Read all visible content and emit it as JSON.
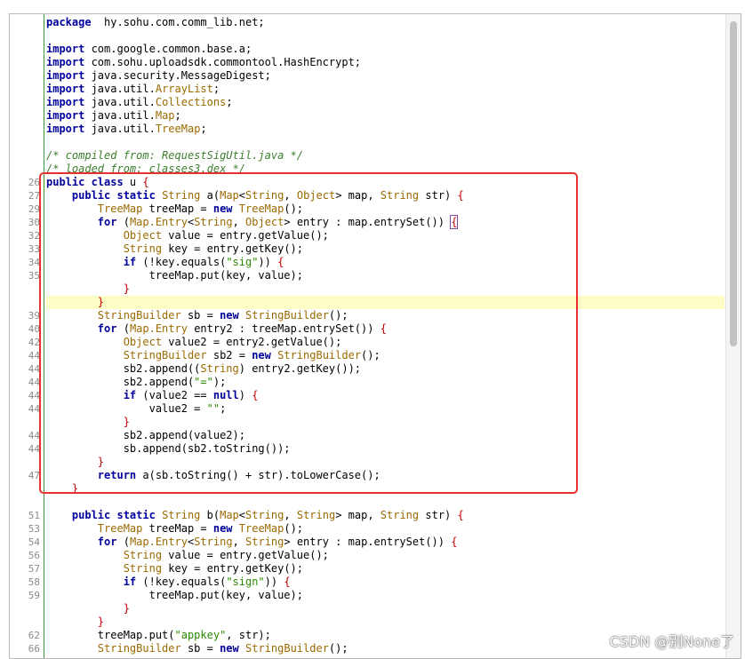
{
  "watermark": "CSDN @别None了",
  "lines": [
    {
      "ln": "",
      "segs": [
        [
          "kw",
          "package"
        ],
        [
          "",
          "  hy.sohu.com.comm_lib.net;"
        ]
      ]
    },
    {
      "ln": "",
      "segs": []
    },
    {
      "ln": "",
      "segs": [
        [
          "kw",
          "import"
        ],
        [
          "",
          " com.google.common.base.a;"
        ]
      ]
    },
    {
      "ln": "",
      "segs": [
        [
          "kw",
          "import"
        ],
        [
          "",
          " com.sohu.uploadsdk.commontool.HashEncrypt;"
        ]
      ]
    },
    {
      "ln": "",
      "segs": [
        [
          "kw",
          "import"
        ],
        [
          "",
          " java.security.MessageDigest;"
        ]
      ]
    },
    {
      "ln": "",
      "segs": [
        [
          "kw",
          "import"
        ],
        [
          "",
          " java.util."
        ],
        [
          "ty",
          "ArrayList"
        ],
        [
          "",
          ";"
        ]
      ]
    },
    {
      "ln": "",
      "segs": [
        [
          "kw",
          "import"
        ],
        [
          "",
          " java.util."
        ],
        [
          "ty",
          "Collections"
        ],
        [
          "",
          ";"
        ]
      ]
    },
    {
      "ln": "",
      "segs": [
        [
          "kw",
          "import"
        ],
        [
          "",
          " java.util."
        ],
        [
          "ty",
          "Map"
        ],
        [
          "",
          ";"
        ]
      ]
    },
    {
      "ln": "",
      "segs": [
        [
          "kw",
          "import"
        ],
        [
          "",
          " java.util."
        ],
        [
          "ty",
          "TreeMap"
        ],
        [
          "",
          ";"
        ]
      ]
    },
    {
      "ln": "",
      "segs": []
    },
    {
      "ln": "",
      "segs": [
        [
          "cm",
          "/* compiled from: RequestSigUtil.java */"
        ]
      ]
    },
    {
      "ln": "",
      "segs": [
        [
          "cm",
          "/* loaded from: classes3.dex */"
        ]
      ]
    },
    {
      "ln": "26",
      "segs": [
        [
          "kw",
          "public class"
        ],
        [
          "",
          " u "
        ],
        [
          "br",
          "{"
        ]
      ]
    },
    {
      "ln": "27",
      "segs": [
        [
          "",
          "    "
        ],
        [
          "kw",
          "public static"
        ],
        [
          "",
          " "
        ],
        [
          "ty",
          "String"
        ],
        [
          "",
          " a("
        ],
        [
          "ty",
          "Map"
        ],
        [
          "",
          "<"
        ],
        [
          "ty",
          "String"
        ],
        [
          "",
          ", "
        ],
        [
          "ty",
          "Object"
        ],
        [
          "",
          "> map, "
        ],
        [
          "ty",
          "String"
        ],
        [
          "",
          " str) "
        ],
        [
          "br",
          "{"
        ]
      ]
    },
    {
      "ln": "29",
      "segs": [
        [
          "",
          "        "
        ],
        [
          "ty",
          "TreeMap"
        ],
        [
          "",
          " treeMap = "
        ],
        [
          "kw",
          "new"
        ],
        [
          "",
          " "
        ],
        [
          "ty",
          "TreeMap"
        ],
        [
          "",
          "();"
        ]
      ]
    },
    {
      "ln": "30",
      "segs": [
        [
          "",
          "        "
        ],
        [
          "kw",
          "for"
        ],
        [
          "",
          " ("
        ],
        [
          "ty",
          "Map.Entry"
        ],
        [
          "",
          "<"
        ],
        [
          "ty",
          "String"
        ],
        [
          "",
          ", "
        ],
        [
          "ty",
          "Object"
        ],
        [
          "",
          "> entry : map.entrySet()) "
        ],
        [
          "cur",
          "{"
        ]
      ]
    },
    {
      "ln": "32",
      "segs": [
        [
          "",
          "            "
        ],
        [
          "ty",
          "Object"
        ],
        [
          "",
          " value = entry.getValue();"
        ]
      ]
    },
    {
      "ln": "33",
      "segs": [
        [
          "",
          "            "
        ],
        [
          "ty",
          "String"
        ],
        [
          "",
          " key = entry.getKey();"
        ]
      ]
    },
    {
      "ln": "34",
      "segs": [
        [
          "",
          "            "
        ],
        [
          "kw",
          "if"
        ],
        [
          "",
          " (!key.equals("
        ],
        [
          "str",
          "\"sig\""
        ],
        [
          "",
          ")) "
        ],
        [
          "br",
          "{"
        ]
      ]
    },
    {
      "ln": "35",
      "segs": [
        [
          "",
          "                treeMap.put(key, value);"
        ]
      ]
    },
    {
      "ln": "",
      "segs": [
        [
          "",
          "            "
        ],
        [
          "br",
          "}"
        ]
      ]
    },
    {
      "ln": "",
      "hl": true,
      "segs": [
        [
          "",
          "        "
        ],
        [
          "br",
          "}"
        ]
      ]
    },
    {
      "ln": "39",
      "segs": [
        [
          "",
          "        "
        ],
        [
          "ty",
          "StringBuilder"
        ],
        [
          "",
          " sb = "
        ],
        [
          "kw",
          "new"
        ],
        [
          "",
          " "
        ],
        [
          "ty",
          "StringBuilder"
        ],
        [
          "",
          "();"
        ]
      ]
    },
    {
      "ln": "40",
      "segs": [
        [
          "",
          "        "
        ],
        [
          "kw",
          "for"
        ],
        [
          "",
          " ("
        ],
        [
          "ty",
          "Map.Entry"
        ],
        [
          "",
          " entry2 : treeMap.entrySet()) "
        ],
        [
          "br",
          "{"
        ]
      ]
    },
    {
      "ln": "42",
      "segs": [
        [
          "",
          "            "
        ],
        [
          "ty",
          "Object"
        ],
        [
          "",
          " value2 = entry2.getValue();"
        ]
      ]
    },
    {
      "ln": "44",
      "segs": [
        [
          "",
          "            "
        ],
        [
          "ty",
          "StringBuilder"
        ],
        [
          "",
          " sb2 = "
        ],
        [
          "kw",
          "new"
        ],
        [
          "",
          " "
        ],
        [
          "ty",
          "StringBuilder"
        ],
        [
          "",
          "();"
        ]
      ]
    },
    {
      "ln": "44",
      "segs": [
        [
          "",
          "            sb2.append(("
        ],
        [
          "ty",
          "String"
        ],
        [
          "",
          ") entry2.getKey());"
        ]
      ]
    },
    {
      "ln": "44",
      "segs": [
        [
          "",
          "            sb2.append("
        ],
        [
          "str",
          "\"=\""
        ],
        [
          "",
          ");"
        ]
      ]
    },
    {
      "ln": "44",
      "segs": [
        [
          "",
          "            "
        ],
        [
          "kw",
          "if"
        ],
        [
          "",
          " (value2 == "
        ],
        [
          "kw",
          "null"
        ],
        [
          "",
          ") "
        ],
        [
          "br",
          "{"
        ]
      ]
    },
    {
      "ln": "44",
      "segs": [
        [
          "",
          "                value2 = "
        ],
        [
          "str",
          "\"\""
        ],
        [
          "",
          ";"
        ]
      ]
    },
    {
      "ln": "",
      "segs": [
        [
          "",
          "            "
        ],
        [
          "br",
          "}"
        ]
      ]
    },
    {
      "ln": "44",
      "segs": [
        [
          "",
          "            sb2.append(value2);"
        ]
      ]
    },
    {
      "ln": "44",
      "segs": [
        [
          "",
          "            sb.append(sb2.toString());"
        ]
      ]
    },
    {
      "ln": "",
      "segs": [
        [
          "",
          "        "
        ],
        [
          "br",
          "}"
        ]
      ]
    },
    {
      "ln": "47",
      "segs": [
        [
          "",
          "        "
        ],
        [
          "kw",
          "return"
        ],
        [
          "",
          " a(sb.toString() + str).toLowerCase();"
        ]
      ]
    },
    {
      "ln": "",
      "segs": [
        [
          "",
          "    "
        ],
        [
          "br",
          "}"
        ]
      ]
    },
    {
      "ln": "",
      "segs": []
    },
    {
      "ln": "51",
      "segs": [
        [
          "",
          "    "
        ],
        [
          "kw",
          "public static"
        ],
        [
          "",
          " "
        ],
        [
          "ty",
          "String"
        ],
        [
          "",
          " b("
        ],
        [
          "ty",
          "Map"
        ],
        [
          "",
          "<"
        ],
        [
          "ty",
          "String"
        ],
        [
          "",
          ", "
        ],
        [
          "ty",
          "String"
        ],
        [
          "",
          "> map, "
        ],
        [
          "ty",
          "String"
        ],
        [
          "",
          " str) "
        ],
        [
          "br",
          "{"
        ]
      ]
    },
    {
      "ln": "53",
      "segs": [
        [
          "",
          "        "
        ],
        [
          "ty",
          "TreeMap"
        ],
        [
          "",
          " treeMap = "
        ],
        [
          "kw",
          "new"
        ],
        [
          "",
          " "
        ],
        [
          "ty",
          "TreeMap"
        ],
        [
          "",
          "();"
        ]
      ]
    },
    {
      "ln": "54",
      "segs": [
        [
          "",
          "        "
        ],
        [
          "kw",
          "for"
        ],
        [
          "",
          " ("
        ],
        [
          "ty",
          "Map.Entry"
        ],
        [
          "",
          "<"
        ],
        [
          "ty",
          "String"
        ],
        [
          "",
          ", "
        ],
        [
          "ty",
          "String"
        ],
        [
          "",
          "> entry : map.entrySet()) "
        ],
        [
          "br",
          "{"
        ]
      ]
    },
    {
      "ln": "56",
      "segs": [
        [
          "",
          "            "
        ],
        [
          "ty",
          "String"
        ],
        [
          "",
          " value = entry.getValue();"
        ]
      ]
    },
    {
      "ln": "57",
      "segs": [
        [
          "",
          "            "
        ],
        [
          "ty",
          "String"
        ],
        [
          "",
          " key = entry.getKey();"
        ]
      ]
    },
    {
      "ln": "58",
      "segs": [
        [
          "",
          "            "
        ],
        [
          "kw",
          "if"
        ],
        [
          "",
          " (!key.equals("
        ],
        [
          "str",
          "\"sign\""
        ],
        [
          "",
          ")) "
        ],
        [
          "br",
          "{"
        ]
      ]
    },
    {
      "ln": "59",
      "segs": [
        [
          "",
          "                treeMap.put(key, value);"
        ]
      ]
    },
    {
      "ln": "",
      "segs": [
        [
          "",
          "            "
        ],
        [
          "br",
          "}"
        ]
      ]
    },
    {
      "ln": "",
      "segs": [
        [
          "",
          "        "
        ],
        [
          "br",
          "}"
        ]
      ]
    },
    {
      "ln": "62",
      "segs": [
        [
          "",
          "        treeMap.put("
        ],
        [
          "str",
          "\"appkey\""
        ],
        [
          "",
          ", str);"
        ]
      ]
    },
    {
      "ln": "66",
      "segs": [
        [
          "",
          "        "
        ],
        [
          "ty",
          "StringBuilder"
        ],
        [
          "",
          " sb = "
        ],
        [
          "kw",
          "new"
        ],
        [
          "",
          " "
        ],
        [
          "ty",
          "StringBuilder"
        ],
        [
          "",
          "();"
        ]
      ]
    }
  ]
}
